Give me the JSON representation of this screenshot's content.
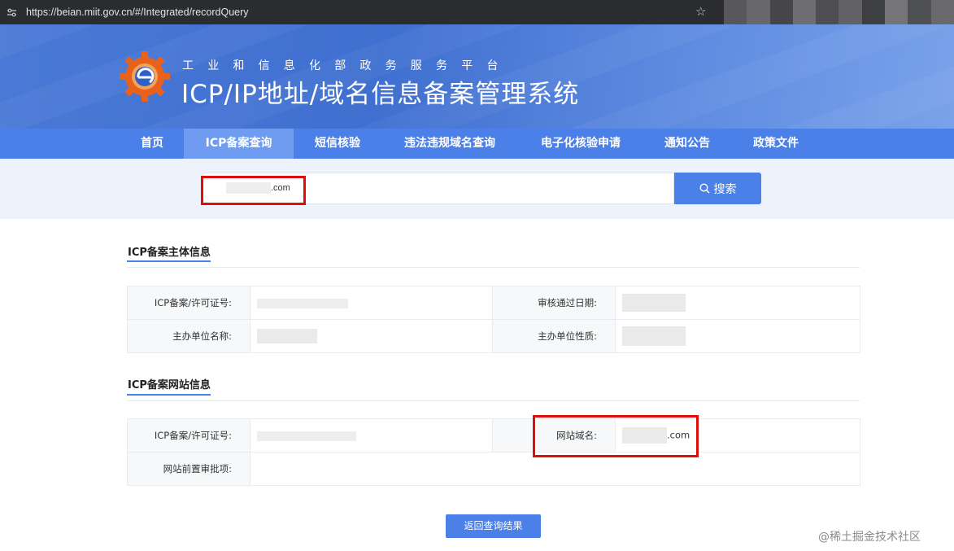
{
  "browser": {
    "url": "https://beian.miit.gov.cn/#/Integrated/recordQuery",
    "tune_icon": "site-info-icon",
    "star_icon": "bookmark-star-icon",
    "extension_colors": [
      "#7b7c80",
      "#9a9b9e",
      "#5c5d61",
      "#a5a4a7",
      "#6b6a70",
      "#8f8e92",
      "#4f5054",
      "#b3b2b5",
      "#6e6f73",
      "#9d9ca0"
    ]
  },
  "header": {
    "subtitle": "工业和信息化部政务服务平台",
    "title": "ICP/IP地址/域名信息备案管理系统",
    "logo_icon": "gear-e-logo-icon"
  },
  "nav": {
    "items": [
      {
        "label": "首页",
        "active": false
      },
      {
        "label": "ICP备案查询",
        "active": true
      },
      {
        "label": "短信核验",
        "active": false
      },
      {
        "label": "违法违规域名查询",
        "active": false
      },
      {
        "label": "电子化核验申请",
        "active": false
      },
      {
        "label": "通知公告",
        "active": false
      },
      {
        "label": "政策文件",
        "active": false
      }
    ]
  },
  "search": {
    "input_value": ".com",
    "button_label": "搜索",
    "button_icon": "search-icon"
  },
  "section_entity": {
    "title": "ICP备案主体信息",
    "rows": [
      {
        "label1": "ICP备案/许可证号:",
        "value1": "",
        "label2": "审核通过日期:",
        "value2": ""
      },
      {
        "label1": "主办单位名称:",
        "value1": "",
        "label2": "主办单位性质:",
        "value2": ""
      }
    ]
  },
  "section_website": {
    "title": "ICP备案网站信息",
    "rows": [
      {
        "label1": "ICP备案/许可证号:",
        "value1": "",
        "label2": "网站域名:",
        "value2": ".com"
      },
      {
        "label1": "网站前置审批项:",
        "value1": ""
      }
    ]
  },
  "actions": {
    "back_label": "返回查询结果"
  },
  "watermark": "@稀土掘金技术社区",
  "colors": {
    "primary": "#4b80e8",
    "nav_active": "#6f9cf0",
    "highlight_red": "#e00d0d",
    "search_bg": "#eef3fb"
  }
}
